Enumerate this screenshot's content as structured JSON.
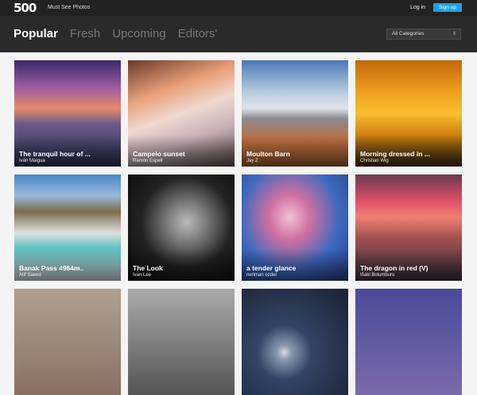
{
  "header": {
    "logo": "500",
    "tagline": "Must See Photos",
    "login_label": "Log in",
    "signup_label": "Sign up"
  },
  "nav": {
    "tabs": [
      {
        "label": "Popular",
        "active": true
      },
      {
        "label": "Fresh",
        "active": false
      },
      {
        "label": "Upcoming",
        "active": false
      },
      {
        "label": "Editors'",
        "active": false
      }
    ],
    "category_selected": "All Categories"
  },
  "photos": [
    {
      "title": "The tranquil hour of ...",
      "author": "Iván Maigua"
    },
    {
      "title": "Campelo sunset",
      "author": "Ramón Espelt"
    },
    {
      "title": "Moulton Barn",
      "author": "Jay Z"
    },
    {
      "title": "Morning dressed in ...",
      "author": "Christian Wig"
    },
    {
      "title": "Banak Pass 4964m..",
      "author": "Atif Saeed"
    },
    {
      "title": "The Look",
      "author": "Ivan Lee"
    },
    {
      "title": "a tender glance",
      "author": "neriman ozder"
    },
    {
      "title": "The dragon in red (V)",
      "author": "Iñaki Bolumburu"
    },
    {
      "title": "",
      "author": ""
    },
    {
      "title": "",
      "author": ""
    },
    {
      "title": "",
      "author": ""
    },
    {
      "title": "",
      "author": ""
    }
  ]
}
